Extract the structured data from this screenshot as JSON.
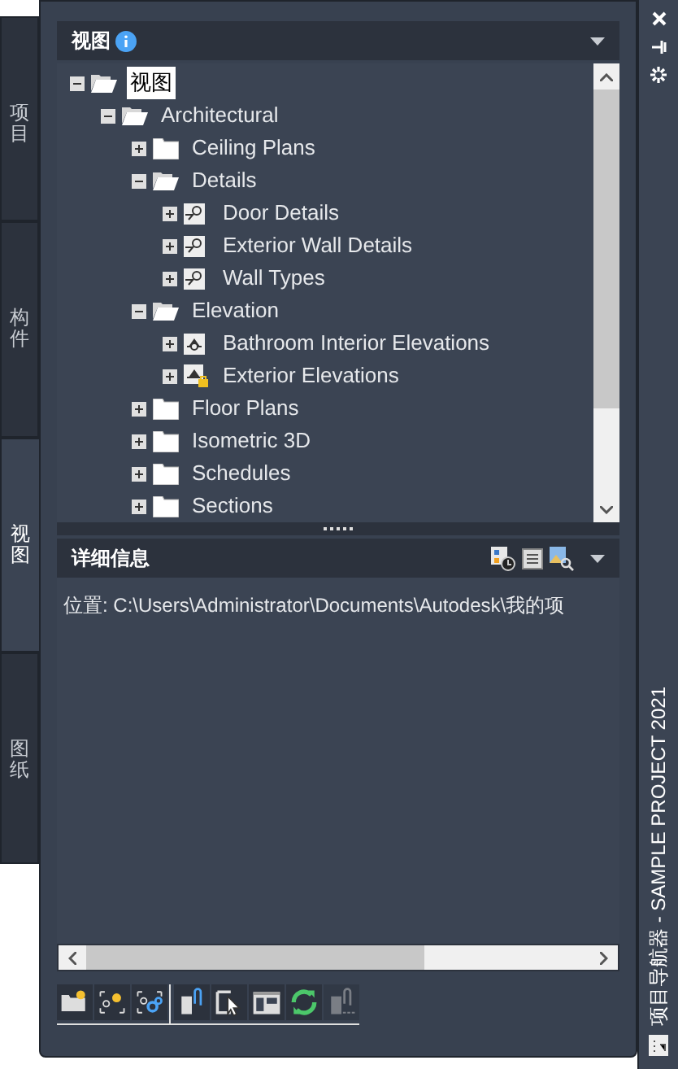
{
  "side_tabs": [
    {
      "label": "项目",
      "selected": false
    },
    {
      "label": "构件",
      "selected": false
    },
    {
      "label": "视图",
      "selected": true
    },
    {
      "label": "图纸",
      "selected": false
    }
  ],
  "views_panel": {
    "title": "视图",
    "tree": [
      {
        "label": "视图",
        "kind": "folder",
        "expanded": true,
        "selected": true,
        "children": [
          {
            "label": "Architectural",
            "kind": "folder",
            "expanded": true,
            "selected": false,
            "children": [
              {
                "label": "Ceiling Plans",
                "kind": "folder",
                "expanded": false,
                "selected": false
              },
              {
                "label": "Details",
                "kind": "folder",
                "expanded": true,
                "selected": false,
                "children": [
                  {
                    "label": "Door Details",
                    "kind": "detail",
                    "expanded": false,
                    "selected": false
                  },
                  {
                    "label": "Exterior Wall Details",
                    "kind": "detail",
                    "expanded": false,
                    "selected": false
                  },
                  {
                    "label": "Wall Types",
                    "kind": "detail",
                    "expanded": false,
                    "selected": false
                  }
                ]
              },
              {
                "label": "Elevation",
                "kind": "folder",
                "expanded": true,
                "selected": false,
                "children": [
                  {
                    "label": "Bathroom Interior Elevations",
                    "kind": "elevation",
                    "expanded": false,
                    "selected": false
                  },
                  {
                    "label": "Exterior Elevations",
                    "kind": "elevation-locked",
                    "expanded": false,
                    "selected": false
                  }
                ]
              },
              {
                "label": "Floor Plans",
                "kind": "folder",
                "expanded": false,
                "selected": false
              },
              {
                "label": "Isometric 3D",
                "kind": "folder",
                "expanded": false,
                "selected": false
              },
              {
                "label": "Schedules",
                "kind": "folder",
                "expanded": false,
                "selected": false
              },
              {
                "label": "Sections",
                "kind": "folder",
                "expanded": false,
                "selected": false
              }
            ]
          }
        ]
      }
    ]
  },
  "details_panel": {
    "title": "详细信息",
    "location": "位置: C:\\Users\\Administrator\\Documents\\Autodesk\\我的项"
  },
  "toolbar_groups": [
    [
      {
        "kind": "new-folder",
        "disabled": false
      },
      {
        "kind": "new-view",
        "disabled": false
      },
      {
        "kind": "view-settings",
        "disabled": false
      }
    ],
    [
      {
        "kind": "attach",
        "disabled": false
      },
      {
        "kind": "select",
        "disabled": false
      },
      {
        "kind": "layout",
        "disabled": false
      },
      {
        "kind": "refresh",
        "disabled": false
      },
      {
        "kind": "detach",
        "disabled": true
      }
    ]
  ],
  "title_strip": "项目导航器 - SAMPLE PROJECT 2021"
}
